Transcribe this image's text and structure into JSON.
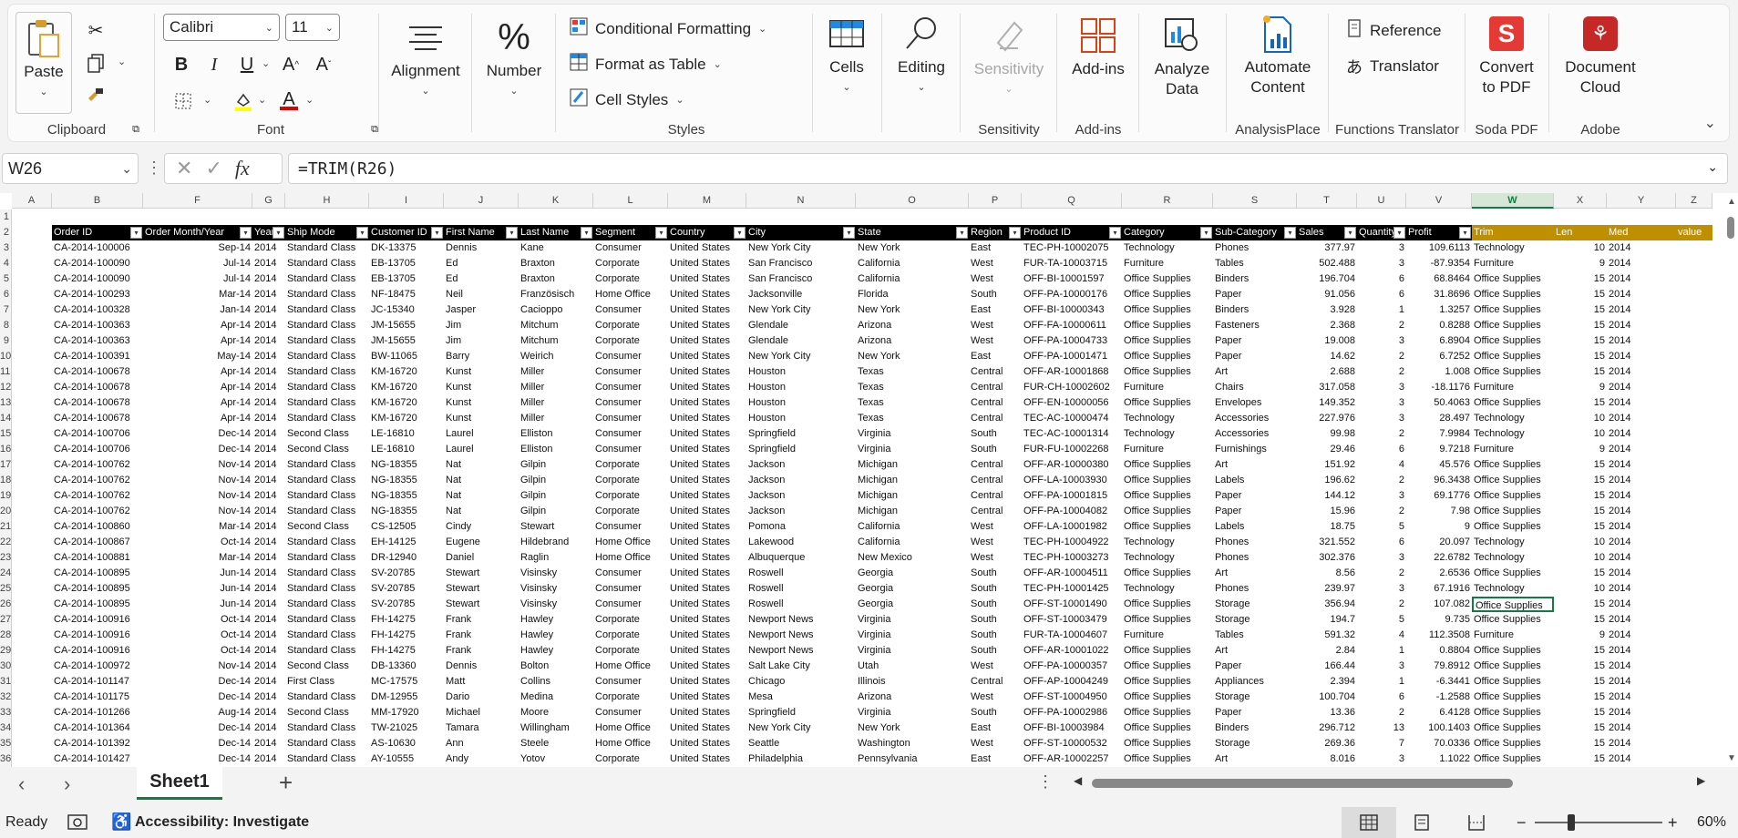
{
  "ribbon": {
    "clipboard": {
      "paste": "Paste",
      "label": "Clipboard"
    },
    "font": {
      "name": "Calibri",
      "size": "11",
      "label": "Font"
    },
    "alignment": {
      "label": "Alignment"
    },
    "number": {
      "label": "Number"
    },
    "styles": {
      "conditional": "Conditional Formatting",
      "table": "Format as Table",
      "cell_styles": "Cell Styles",
      "label": "Styles"
    },
    "cells": {
      "label": "Cells"
    },
    "editing": {
      "label": "Editing"
    },
    "sensitivity": {
      "btn": "Sensitivity",
      "label": "Sensitivity"
    },
    "addins": {
      "btn": "Add-ins",
      "label": "Add-ins"
    },
    "analyze": {
      "btn1": "Analyze",
      "btn2": "Data"
    },
    "automate": {
      "btn1": "Automate",
      "btn2": "Content",
      "label": "AnalysisPlace"
    },
    "functions": {
      "reference": "Reference",
      "translator": "Translator",
      "label": "Functions Translator"
    },
    "soda": {
      "btn1": "Convert",
      "btn2": "to PDF",
      "label": "Soda PDF"
    },
    "adobe": {
      "btn1": "Document",
      "btn2": "Cloud",
      "label": "Adobe"
    }
  },
  "formula_bar": {
    "name_box": "W26",
    "fx": "fx",
    "formula": "=TRIM(R26)"
  },
  "columns": [
    "A",
    "B",
    "F",
    "G",
    "H",
    "I",
    "J",
    "K",
    "L",
    "M",
    "N",
    "O",
    "P",
    "Q",
    "R",
    "S",
    "T",
    "U",
    "V",
    "W",
    "X",
    "Y",
    "Z"
  ],
  "headers": [
    "Order ID",
    "Order Month/Year",
    "Year",
    "Ship Mode",
    "Customer ID",
    "First Name",
    "Last Name",
    "Segment",
    "Country",
    "City",
    "State",
    "Region",
    "Product ID",
    "Category",
    "Sub-Category",
    "Sales",
    "Quantity",
    "Profit",
    "Trim",
    "Len",
    "Med",
    "value"
  ],
  "row_numbers": [
    "1",
    "2",
    "3",
    "4",
    "5",
    "6",
    "7",
    "8",
    "9",
    "10",
    "11",
    "12",
    "13",
    "14",
    "15",
    "16",
    "17",
    "18",
    "19",
    "20",
    "21",
    "22",
    "23",
    "24",
    "25",
    "26",
    "27",
    "28",
    "29",
    "30",
    "31",
    "32",
    "33",
    "34",
    "35",
    "36"
  ],
  "rows": [
    [
      "CA-2014-100006",
      "Sep-14",
      "2014",
      "Standard Class",
      "DK-13375",
      "Dennis",
      "Kane",
      "Consumer",
      "United States",
      "New York City",
      "New York",
      "East",
      "TEC-PH-10002075",
      "Technology",
      "Phones",
      "377.97",
      "3",
      "109.6113",
      "Technology",
      "10",
      "2014"
    ],
    [
      "CA-2014-100090",
      "Jul-14",
      "2014",
      "Standard Class",
      "EB-13705",
      "Ed",
      "Braxton",
      "Corporate",
      "United States",
      "San Francisco",
      "California",
      "West",
      "FUR-TA-10003715",
      "Furniture",
      "Tables",
      "502.488",
      "3",
      "-87.9354",
      "Furniture",
      "9",
      "2014"
    ],
    [
      "CA-2014-100090",
      "Jul-14",
      "2014",
      "Standard Class",
      "EB-13705",
      "Ed",
      "Braxton",
      "Corporate",
      "United States",
      "San Francisco",
      "California",
      "West",
      "OFF-BI-10001597",
      "Office Supplies",
      "Binders",
      "196.704",
      "6",
      "68.8464",
      "Office Supplies",
      "15",
      "2014"
    ],
    [
      "CA-2014-100293",
      "Mar-14",
      "2014",
      "Standard Class",
      "NF-18475",
      "Neil",
      "Französisch",
      "Home Office",
      "United States",
      "Jacksonville",
      "Florida",
      "South",
      "OFF-PA-10000176",
      "Office Supplies",
      "Paper",
      "91.056",
      "6",
      "31.8696",
      "Office Supplies",
      "15",
      "2014"
    ],
    [
      "CA-2014-100328",
      "Jan-14",
      "2014",
      "Standard Class",
      "JC-15340",
      "Jasper",
      "Cacioppo",
      "Consumer",
      "United States",
      "New York City",
      "New York",
      "East",
      "OFF-BI-10000343",
      "Office Supplies",
      "Binders",
      "3.928",
      "1",
      "1.3257",
      "Office Supplies",
      "15",
      "2014"
    ],
    [
      "CA-2014-100363",
      "Apr-14",
      "2014",
      "Standard Class",
      "JM-15655",
      "Jim",
      "Mitchum",
      "Corporate",
      "United States",
      "Glendale",
      "Arizona",
      "West",
      "OFF-FA-10000611",
      "Office Supplies",
      "Fasteners",
      "2.368",
      "2",
      "0.8288",
      "Office Supplies",
      "15",
      "2014"
    ],
    [
      "CA-2014-100363",
      "Apr-14",
      "2014",
      "Standard Class",
      "JM-15655",
      "Jim",
      "Mitchum",
      "Corporate",
      "United States",
      "Glendale",
      "Arizona",
      "West",
      "OFF-PA-10004733",
      "Office Supplies",
      "Paper",
      "19.008",
      "3",
      "6.8904",
      "Office Supplies",
      "15",
      "2014"
    ],
    [
      "CA-2014-100391",
      "May-14",
      "2014",
      "Standard Class",
      "BW-11065",
      "Barry",
      "Weirich",
      "Consumer",
      "United States",
      "New York City",
      "New York",
      "East",
      "OFF-PA-10001471",
      "Office Supplies",
      "Paper",
      "14.62",
      "2",
      "6.7252",
      "Office Supplies",
      "15",
      "2014"
    ],
    [
      "CA-2014-100678",
      "Apr-14",
      "2014",
      "Standard Class",
      "KM-16720",
      "Kunst",
      "Miller",
      "Consumer",
      "United States",
      "Houston",
      "Texas",
      "Central",
      "OFF-AR-10001868",
      "Office Supplies",
      "Art",
      "2.688",
      "2",
      "1.008",
      "Office Supplies",
      "15",
      "2014"
    ],
    [
      "CA-2014-100678",
      "Apr-14",
      "2014",
      "Standard Class",
      "KM-16720",
      "Kunst",
      "Miller",
      "Consumer",
      "United States",
      "Houston",
      "Texas",
      "Central",
      "FUR-CH-10002602",
      "Furniture",
      "Chairs",
      "317.058",
      "3",
      "-18.1176",
      "Furniture",
      "9",
      "2014"
    ],
    [
      "CA-2014-100678",
      "Apr-14",
      "2014",
      "Standard Class",
      "KM-16720",
      "Kunst",
      "Miller",
      "Consumer",
      "United States",
      "Houston",
      "Texas",
      "Central",
      "OFF-EN-10000056",
      "Office Supplies",
      "Envelopes",
      "149.352",
      "3",
      "50.4063",
      "Office Supplies",
      "15",
      "2014"
    ],
    [
      "CA-2014-100678",
      "Apr-14",
      "2014",
      "Standard Class",
      "KM-16720",
      "Kunst",
      "Miller",
      "Consumer",
      "United States",
      "Houston",
      "Texas",
      "Central",
      "TEC-AC-10000474",
      "Technology",
      "Accessories",
      "227.976",
      "3",
      "28.497",
      "Technology",
      "10",
      "2014"
    ],
    [
      "CA-2014-100706",
      "Dec-14",
      "2014",
      "Second Class",
      "LE-16810",
      "Laurel",
      "Elliston",
      "Consumer",
      "United States",
      "Springfield",
      "Virginia",
      "South",
      "TEC-AC-10001314",
      "Technology",
      "Accessories",
      "99.98",
      "2",
      "7.9984",
      "Technology",
      "10",
      "2014"
    ],
    [
      "CA-2014-100706",
      "Dec-14",
      "2014",
      "Second Class",
      "LE-16810",
      "Laurel",
      "Elliston",
      "Consumer",
      "United States",
      "Springfield",
      "Virginia",
      "South",
      "FUR-FU-10002268",
      "Furniture",
      "Furnishings",
      "29.46",
      "6",
      "9.7218",
      "Furniture",
      "9",
      "2014"
    ],
    [
      "CA-2014-100762",
      "Nov-14",
      "2014",
      "Standard Class",
      "NG-18355",
      "Nat",
      "Gilpin",
      "Corporate",
      "United States",
      "Jackson",
      "Michigan",
      "Central",
      "OFF-AR-10000380",
      "Office Supplies",
      "Art",
      "151.92",
      "4",
      "45.576",
      "Office Supplies",
      "15",
      "2014"
    ],
    [
      "CA-2014-100762",
      "Nov-14",
      "2014",
      "Standard Class",
      "NG-18355",
      "Nat",
      "Gilpin",
      "Corporate",
      "United States",
      "Jackson",
      "Michigan",
      "Central",
      "OFF-LA-10003930",
      "Office Supplies",
      "Labels",
      "196.62",
      "2",
      "96.3438",
      "Office Supplies",
      "15",
      "2014"
    ],
    [
      "CA-2014-100762",
      "Nov-14",
      "2014",
      "Standard Class",
      "NG-18355",
      "Nat",
      "Gilpin",
      "Corporate",
      "United States",
      "Jackson",
      "Michigan",
      "Central",
      "OFF-PA-10001815",
      "Office Supplies",
      "Paper",
      "144.12",
      "3",
      "69.1776",
      "Office Supplies",
      "15",
      "2014"
    ],
    [
      "CA-2014-100762",
      "Nov-14",
      "2014",
      "Standard Class",
      "NG-18355",
      "Nat",
      "Gilpin",
      "Corporate",
      "United States",
      "Jackson",
      "Michigan",
      "Central",
      "OFF-PA-10004082",
      "Office Supplies",
      "Paper",
      "15.96",
      "2",
      "7.98",
      "Office Supplies",
      "15",
      "2014"
    ],
    [
      "CA-2014-100860",
      "Mar-14",
      "2014",
      "Second Class",
      "CS-12505",
      "Cindy",
      "Stewart",
      "Consumer",
      "United States",
      "Pomona",
      "California",
      "West",
      "OFF-LA-10001982",
      "Office Supplies",
      "Labels",
      "18.75",
      "5",
      "9",
      "Office Supplies",
      "15",
      "2014"
    ],
    [
      "CA-2014-100867",
      "Oct-14",
      "2014",
      "Standard Class",
      "EH-14125",
      "Eugene",
      "Hildebrand",
      "Home Office",
      "United States",
      "Lakewood",
      "California",
      "West",
      "TEC-PH-10004922",
      "Technology",
      "Phones",
      "321.552",
      "6",
      "20.097",
      "Technology",
      "10",
      "2014"
    ],
    [
      "CA-2014-100881",
      "Mar-14",
      "2014",
      "Standard Class",
      "DR-12940",
      "Daniel",
      "Raglin",
      "Home Office",
      "United States",
      "Albuquerque",
      "New Mexico",
      "West",
      "TEC-PH-10003273",
      "Technology",
      "Phones",
      "302.376",
      "3",
      "22.6782",
      "Technology",
      "10",
      "2014"
    ],
    [
      "CA-2014-100895",
      "Jun-14",
      "2014",
      "Standard Class",
      "SV-20785",
      "Stewart",
      "Visinsky",
      "Consumer",
      "United States",
      "Roswell",
      "Georgia",
      "South",
      "OFF-AR-10004511",
      "Office Supplies",
      "Art",
      "8.56",
      "2",
      "2.6536",
      "Office Supplies",
      "15",
      "2014"
    ],
    [
      "CA-2014-100895",
      "Jun-14",
      "2014",
      "Standard Class",
      "SV-20785",
      "Stewart",
      "Visinsky",
      "Consumer",
      "United States",
      "Roswell",
      "Georgia",
      "South",
      "TEC-PH-10001425",
      "Technology",
      "Phones",
      "239.97",
      "3",
      "67.1916",
      "Technology",
      "10",
      "2014"
    ],
    [
      "CA-2014-100895",
      "Jun-14",
      "2014",
      "Standard Class",
      "SV-20785",
      "Stewart",
      "Visinsky",
      "Consumer",
      "United States",
      "Roswell",
      "Georgia",
      "South",
      "OFF-ST-10001490",
      "Office Supplies",
      "Storage",
      "356.94",
      "2",
      "107.082",
      "Office Supplies",
      "15",
      "2014"
    ],
    [
      "CA-2014-100916",
      "Oct-14",
      "2014",
      "Standard Class",
      "FH-14275",
      "Frank",
      "Hawley",
      "Corporate",
      "United States",
      "Newport News",
      "Virginia",
      "South",
      "OFF-ST-10003479",
      "Office Supplies",
      "Storage",
      "194.7",
      "5",
      "9.735",
      "Office Supplies",
      "15",
      "2014"
    ],
    [
      "CA-2014-100916",
      "Oct-14",
      "2014",
      "Standard Class",
      "FH-14275",
      "Frank",
      "Hawley",
      "Corporate",
      "United States",
      "Newport News",
      "Virginia",
      "South",
      "FUR-TA-10004607",
      "Furniture",
      "Tables",
      "591.32",
      "4",
      "112.3508",
      "Furniture",
      "9",
      "2014"
    ],
    [
      "CA-2014-100916",
      "Oct-14",
      "2014",
      "Standard Class",
      "FH-14275",
      "Frank",
      "Hawley",
      "Corporate",
      "United States",
      "Newport News",
      "Virginia",
      "South",
      "OFF-AR-10001022",
      "Office Supplies",
      "Art",
      "2.84",
      "1",
      "0.8804",
      "Office Supplies",
      "15",
      "2014"
    ],
    [
      "CA-2014-100972",
      "Nov-14",
      "2014",
      "Second Class",
      "DB-13360",
      "Dennis",
      "Bolton",
      "Home Office",
      "United States",
      "Salt Lake City",
      "Utah",
      "West",
      "OFF-PA-10000357",
      "Office Supplies",
      "Paper",
      "166.44",
      "3",
      "79.8912",
      "Office Supplies",
      "15",
      "2014"
    ],
    [
      "CA-2014-101147",
      "Dec-14",
      "2014",
      "First Class",
      "MC-17575",
      "Matt",
      "Collins",
      "Consumer",
      "United States",
      "Chicago",
      "Illinois",
      "Central",
      "OFF-AP-10004249",
      "Office Supplies",
      "Appliances",
      "2.394",
      "1",
      "-6.3441",
      "Office Supplies",
      "15",
      "2014"
    ],
    [
      "CA-2014-101175",
      "Dec-14",
      "2014",
      "Standard Class",
      "DM-12955",
      "Dario",
      "Medina",
      "Corporate",
      "United States",
      "Mesa",
      "Arizona",
      "West",
      "OFF-ST-10004950",
      "Office Supplies",
      "Storage",
      "100.704",
      "6",
      "-1.2588",
      "Office Supplies",
      "15",
      "2014"
    ],
    [
      "CA-2014-101266",
      "Aug-14",
      "2014",
      "Second Class",
      "MM-17920",
      "Michael",
      "Moore",
      "Consumer",
      "United States",
      "Springfield",
      "Virginia",
      "South",
      "OFF-PA-10002986",
      "Office Supplies",
      "Paper",
      "13.36",
      "2",
      "6.4128",
      "Office Supplies",
      "15",
      "2014"
    ],
    [
      "CA-2014-101364",
      "Dec-14",
      "2014",
      "Standard Class",
      "TW-21025",
      "Tamara",
      "Willingham",
      "Home Office",
      "United States",
      "New York City",
      "New York",
      "East",
      "OFF-BI-10003984",
      "Office Supplies",
      "Binders",
      "296.712",
      "13",
      "100.1403",
      "Office Supplies",
      "15",
      "2014"
    ],
    [
      "CA-2014-101392",
      "Dec-14",
      "2014",
      "Standard Class",
      "AS-10630",
      "Ann",
      "Steele",
      "Home Office",
      "United States",
      "Seattle",
      "Washington",
      "West",
      "OFF-ST-10000532",
      "Office Supplies",
      "Storage",
      "269.36",
      "7",
      "70.0336",
      "Office Supplies",
      "15",
      "2014"
    ],
    [
      "CA-2014-101427",
      "Dec-14",
      "2014",
      "Standard Class",
      "AY-10555",
      "Andy",
      "Yotov",
      "Corporate",
      "United States",
      "Philadelphia",
      "Pennsylvania",
      "East",
      "OFF-AR-10002257",
      "Office Supplies",
      "Art",
      "8.016",
      "3",
      "1.1022",
      "Office Supplies",
      "15",
      "2014"
    ]
  ],
  "sheet": {
    "tab": "Sheet1",
    "add": "+"
  },
  "status": {
    "ready": "Ready",
    "accessibility": "Accessibility: Investigate",
    "zoom": "60%"
  },
  "colors": {
    "accent": "#107c41",
    "header_bg": "#000000",
    "gold": "#bf8f00",
    "soda": "#e53935",
    "adobe": "#c62828"
  }
}
